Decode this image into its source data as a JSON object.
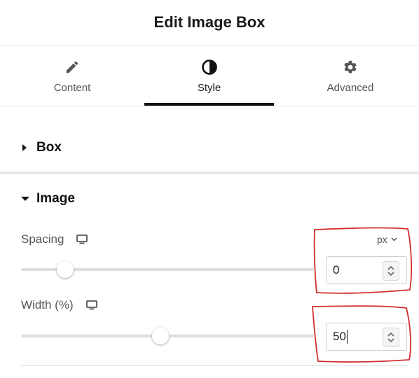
{
  "header": {
    "title": "Edit Image Box"
  },
  "tabs": [
    {
      "label": "Content",
      "icon": "pencil-icon",
      "active": false
    },
    {
      "label": "Style",
      "icon": "contrast-icon",
      "active": true
    },
    {
      "label": "Advanced",
      "icon": "gear-icon",
      "active": false
    }
  ],
  "sections": {
    "box": {
      "title": "Box",
      "expanded": false
    },
    "image": {
      "title": "Image",
      "expanded": true
    }
  },
  "controls": {
    "spacing": {
      "label": "Spacing",
      "unit": "px",
      "value": "0",
      "slider_fraction": 0.15,
      "device_icon": "monitor-icon"
    },
    "width": {
      "label": "Width (%)",
      "value": "50",
      "slider_fraction": 0.475,
      "device_icon": "monitor-icon"
    }
  },
  "colors": {
    "accent": "#111111",
    "annotation": "#d32f2f"
  }
}
